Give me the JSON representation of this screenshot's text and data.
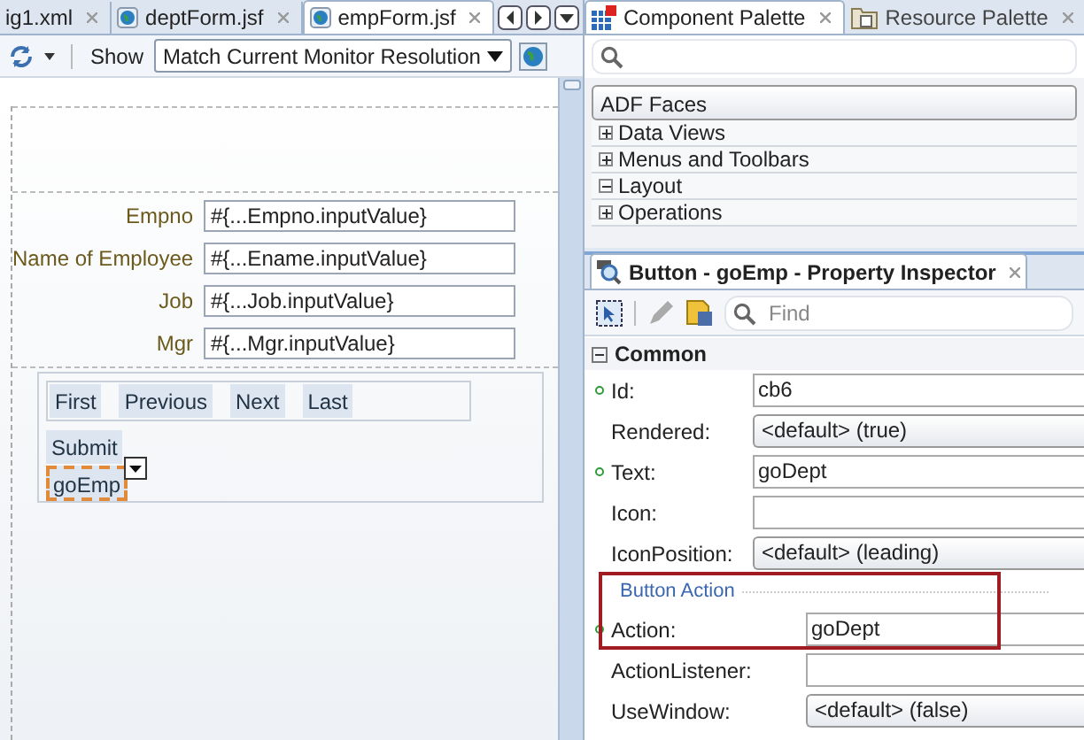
{
  "editor": {
    "tabs": [
      {
        "label": "ig1.xml",
        "selected": false
      },
      {
        "label": "deptForm.jsf",
        "selected": false
      },
      {
        "label": "empForm.jsf",
        "selected": true
      }
    ],
    "toolbar": {
      "show_label": "Show",
      "resolution": "Match Current Monitor Resolution"
    },
    "form_fields": [
      {
        "label": "Empno",
        "value": "#{...Empno.inputValue}"
      },
      {
        "label": "Name of Employee",
        "value": "#{...Ename.inputValue}"
      },
      {
        "label": "Job",
        "value": "#{...Job.inputValue}"
      },
      {
        "label": "Mgr",
        "value": "#{...Mgr.inputValue}"
      }
    ],
    "nav_buttons": [
      "First",
      "Previous",
      "Next",
      "Last"
    ],
    "buttons": [
      {
        "label": "Submit",
        "selected": false
      },
      {
        "label": "goEmp",
        "selected": true
      }
    ]
  },
  "palette": {
    "tabs": [
      {
        "label": "Component Palette",
        "selected": true
      },
      {
        "label": "Resource Palette",
        "selected": false
      }
    ],
    "library": "ADF Faces",
    "sections": [
      {
        "label": "Data Views",
        "expanded": false
      },
      {
        "label": "Menus and Toolbars",
        "expanded": false
      },
      {
        "label": "Layout",
        "expanded": true
      },
      {
        "label": "Operations",
        "expanded": false
      }
    ]
  },
  "inspector": {
    "title": "Button - goEmp - Property Inspector",
    "find_placeholder": "Find",
    "section": "Common",
    "properties": [
      {
        "kind": "text",
        "label": "Id:",
        "value": "cb6",
        "set": true
      },
      {
        "kind": "select",
        "label": "Rendered:",
        "value": "<default> (true)",
        "set": false
      },
      {
        "kind": "text",
        "label": "Text:",
        "value": "goDept",
        "set": true
      },
      {
        "kind": "text",
        "label": "Icon:",
        "set": false
      },
      {
        "kind": "select",
        "label": "IconPosition:",
        "value": "<default> (leading)",
        "set": false
      }
    ],
    "subsection": "Button Action",
    "action_properties": [
      {
        "kind": "text",
        "label": "Action:",
        "value": "goDept",
        "set": true
      },
      {
        "kind": "text",
        "label": "ActionListener:",
        "set": false
      },
      {
        "kind": "select",
        "label": "UseWindow:",
        "value": "<default> (false)",
        "set": false
      }
    ]
  }
}
